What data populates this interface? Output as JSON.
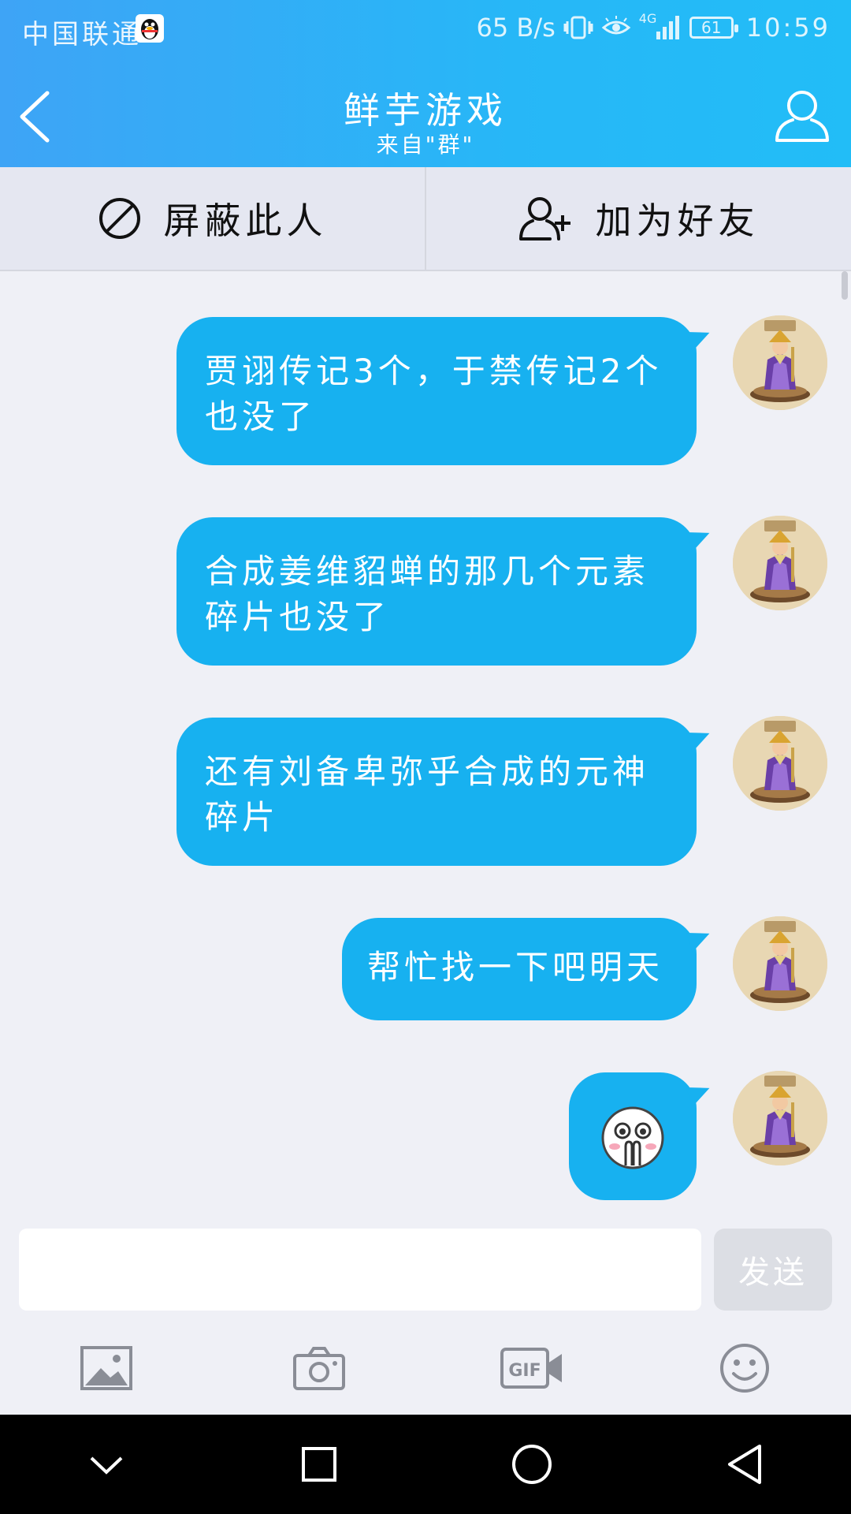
{
  "status_bar": {
    "carrier": "中国联通",
    "net_speed": "65  B/s",
    "network_type": "4G",
    "battery": "61",
    "time": "10:59"
  },
  "header": {
    "title": "鲜芋游戏",
    "subtitle": "来自\"群\""
  },
  "actions": {
    "block_label": "屏蔽此人",
    "add_friend_label": "加为好友"
  },
  "messages": [
    {
      "text": "贾诩传记3个，于禁传记2个\n也没了"
    },
    {
      "text": "合成姜维貂蝉的那几个元素\n碎片也没了"
    },
    {
      "text": "还有刘备卑弥乎合成的元神\n碎片"
    },
    {
      "text": "帮忙找一下吧明天"
    },
    {
      "sticker": "crying-face-sticker"
    }
  ],
  "input": {
    "value": "",
    "send_label": "发送"
  },
  "toolbar": [
    "image-icon",
    "camera-icon",
    "gif-icon",
    "emoji-icon"
  ],
  "navbar": [
    "chevron-down-icon",
    "recents-icon",
    "home-icon",
    "back-triangle-icon"
  ],
  "colors": {
    "header_start": "#3ea4f6",
    "header_end": "#22bdf7",
    "bubble": "#17b1f0",
    "background": "#eff0f6",
    "action_bar": "#e5e7f1"
  }
}
